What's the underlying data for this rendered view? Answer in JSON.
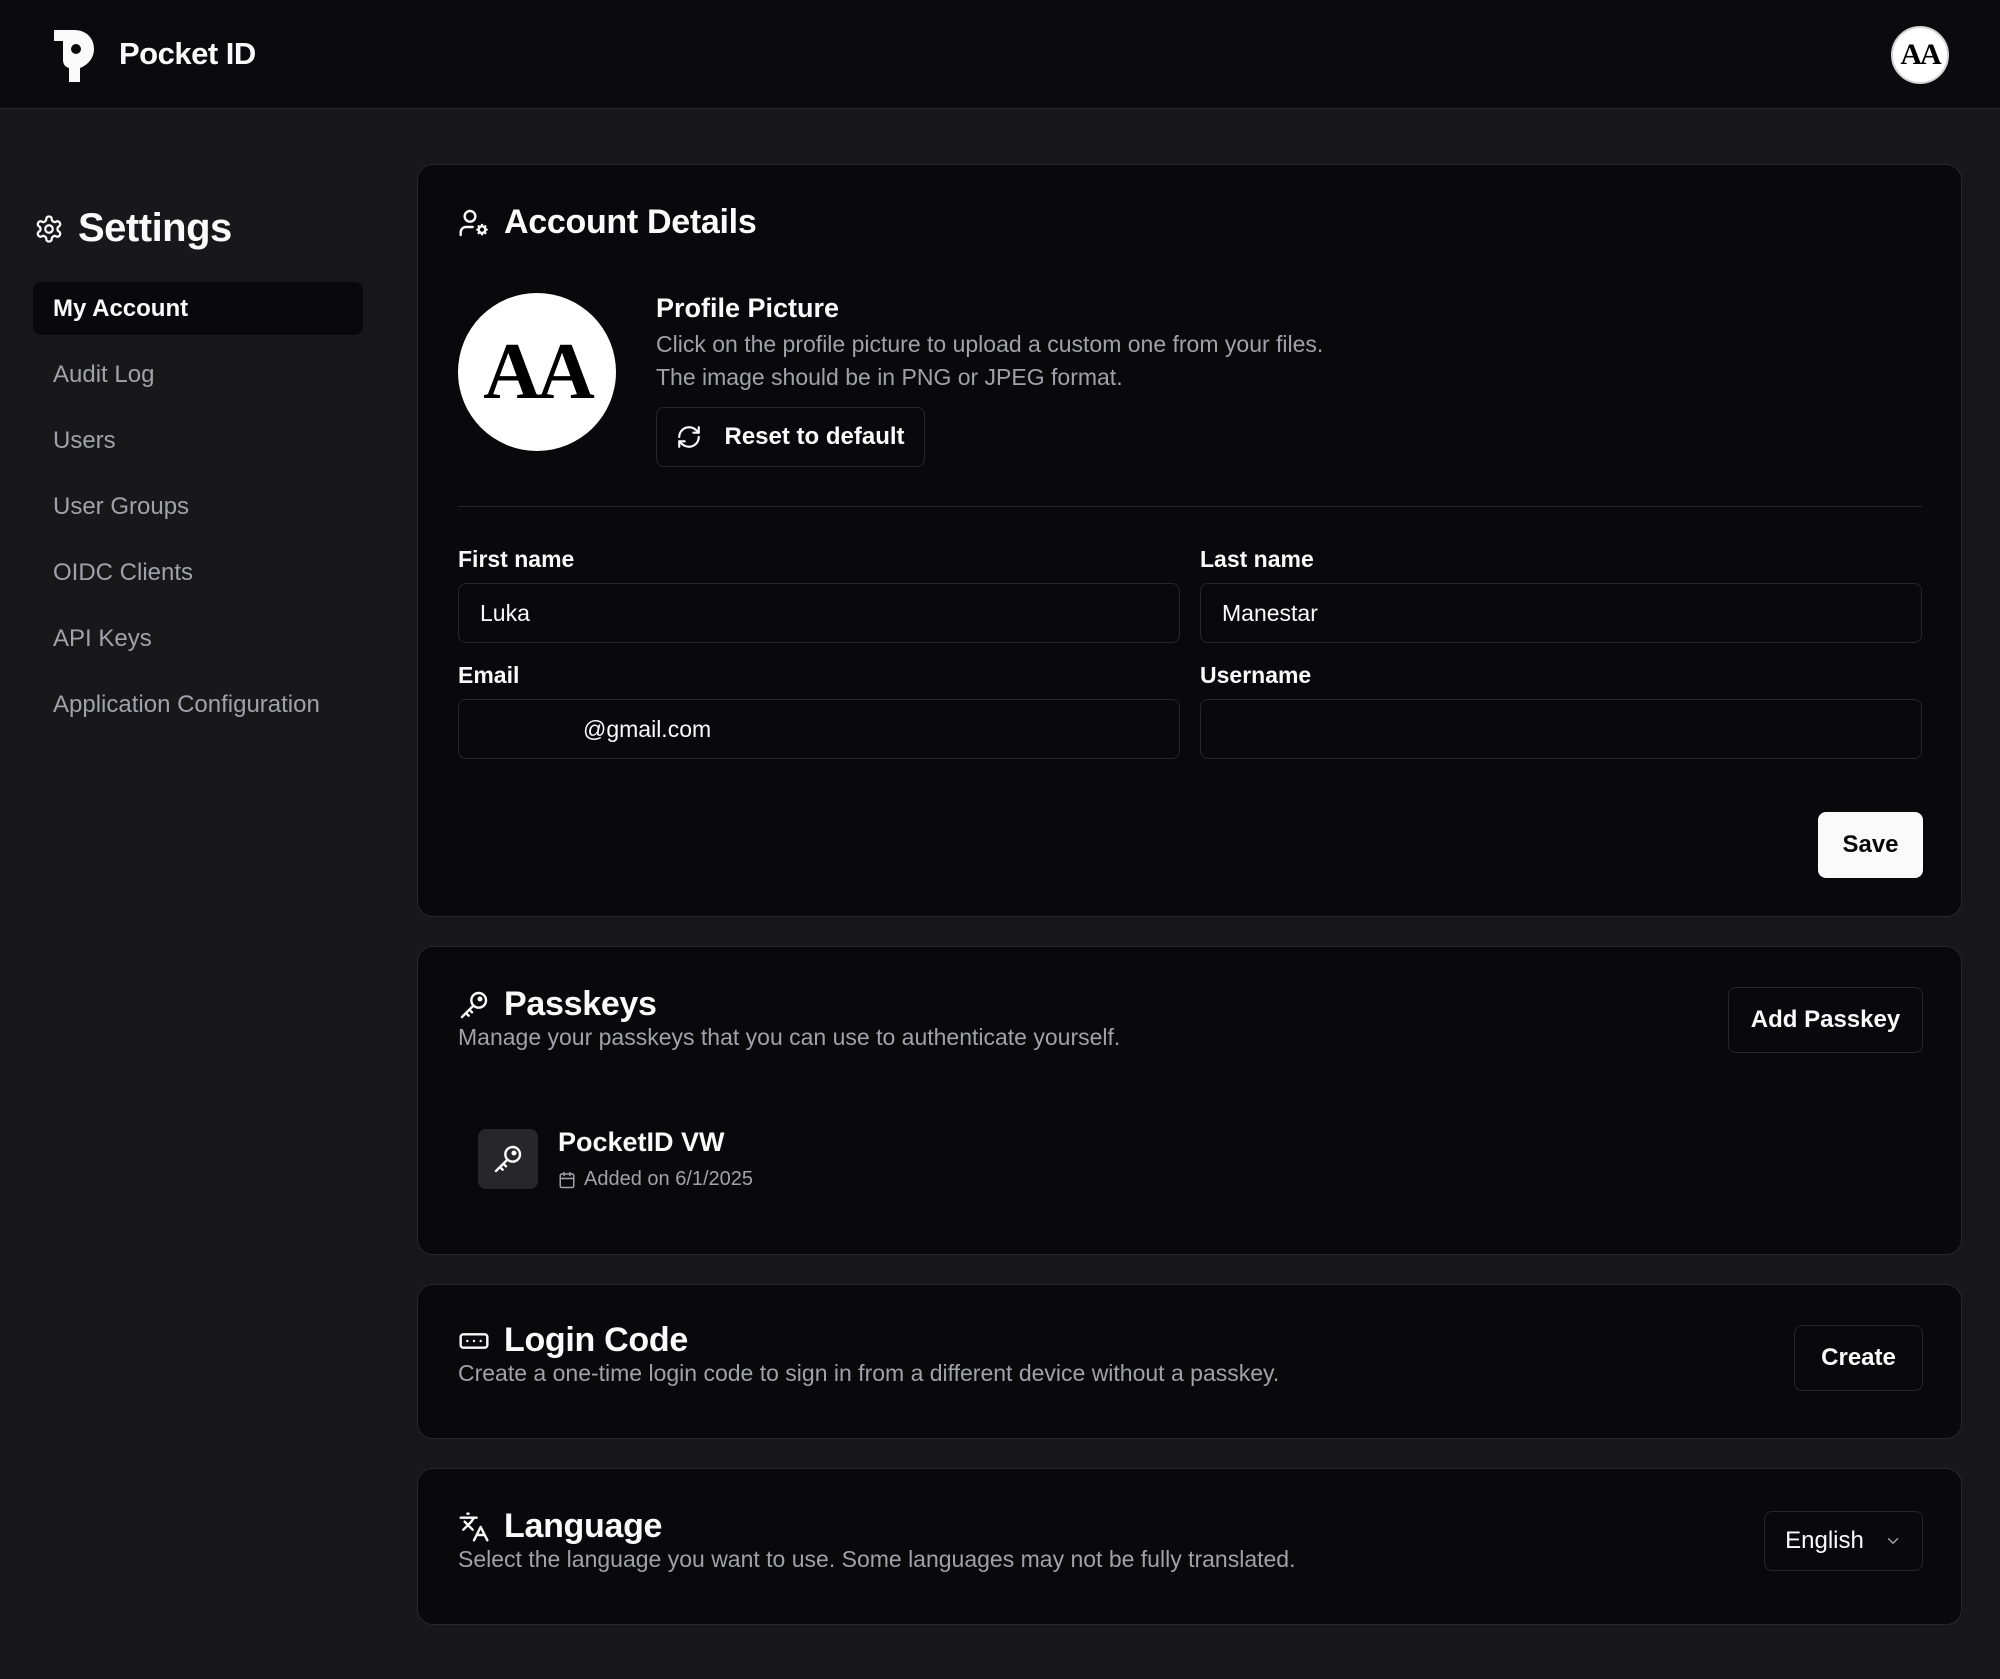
{
  "app": {
    "brand": "Pocket ID",
    "user_initials": "AA"
  },
  "sidebar": {
    "title": "Settings",
    "items": [
      {
        "label": "My Account",
        "active": true
      },
      {
        "label": "Audit Log"
      },
      {
        "label": "Users"
      },
      {
        "label": "User Groups"
      },
      {
        "label": "OIDC Clients"
      },
      {
        "label": "API Keys"
      },
      {
        "label": "Application Configuration"
      }
    ]
  },
  "account": {
    "title": "Account Details",
    "profile_picture": {
      "title": "Profile Picture",
      "initials": "AA",
      "desc_line1": "Click on the profile picture to upload a custom one from your files.",
      "desc_line2": "The image should be in PNG or JPEG format.",
      "reset_label": "Reset to default"
    },
    "first_name": {
      "label": "First name",
      "value": "Luka"
    },
    "last_name": {
      "label": "Last name",
      "value": "Manestar"
    },
    "email": {
      "label": "Email",
      "value": "@gmail.com"
    },
    "username": {
      "label": "Username",
      "value": ""
    },
    "save_label": "Save"
  },
  "passkeys": {
    "title": "Passkeys",
    "desc": "Manage your passkeys that you can use to authenticate yourself.",
    "add_label": "Add Passkey",
    "items": [
      {
        "name": "PocketID VW",
        "added": "Added on 6/1/2025"
      }
    ]
  },
  "login_code": {
    "title": "Login Code",
    "desc": "Create a one-time login code to sign in from a different device without a passkey.",
    "create_label": "Create"
  },
  "language": {
    "title": "Language",
    "desc": "Select the language you want to use. Some languages may not be fully translated.",
    "selected": "English"
  },
  "icons": {
    "logo": "pocket-id-logo",
    "settings": "gear-icon",
    "account": "user-cog-icon",
    "reset": "refresh-icon",
    "passkey": "key-icon",
    "calendar": "calendar-icon",
    "login_code": "rectangle-ellipsis-icon",
    "language": "languages-icon",
    "dropdown": "chevron-down-icon"
  }
}
